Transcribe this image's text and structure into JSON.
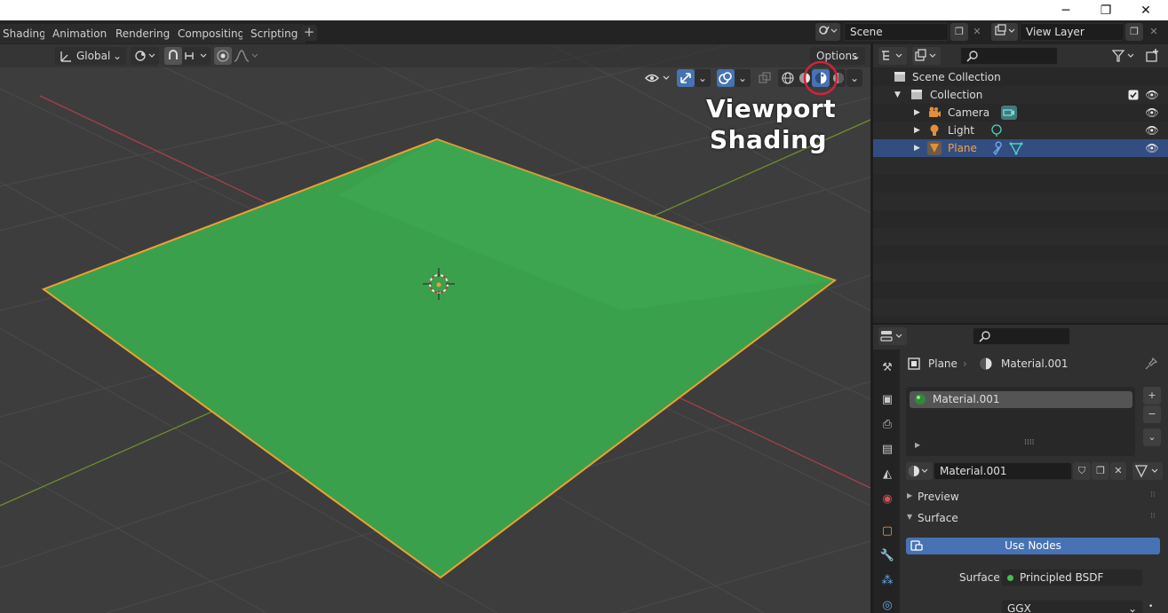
{
  "window": {
    "minimize_glyph": "─",
    "maximize_glyph": "❐",
    "close_glyph": "✕"
  },
  "workspace_tabs": [
    "Shading",
    "Animation",
    "Rendering",
    "Compositing",
    "Scripting"
  ],
  "add_tab_glyph": "+",
  "scene": {
    "name": "Scene"
  },
  "view_layer": {
    "name": "View Layer"
  },
  "viewport": {
    "transform_orientation": "Global",
    "options_label": "Options",
    "annotation_line1": "Viewport",
    "annotation_line2": "Shading",
    "annotation_highlight_color": "#d0243a",
    "plane_color": "#3aa04c",
    "plane_outline_color": "#f0a030",
    "x_axis_color": "#a4414a",
    "y_axis_color": "#6c8f2c"
  },
  "outliner": {
    "scene_collection": "Scene Collection",
    "collection": "Collection",
    "items": [
      {
        "label": "Camera",
        "icon": "camera-icon"
      },
      {
        "label": "Light",
        "icon": "light-icon"
      },
      {
        "label": "Plane",
        "icon": "mesh-icon",
        "selected": true
      }
    ]
  },
  "properties": {
    "breadcrumb_object": "Plane",
    "breadcrumb_material": "Material.001",
    "material_slots": [
      "Material.001"
    ],
    "material_name": "Material.001",
    "panels": {
      "preview": "Preview",
      "surface": "Surface"
    },
    "use_nodes_label": "Use Nodes",
    "surface_label": "Surface",
    "surface_value": "Principled BSDF",
    "distribution_value": "GGX",
    "accent_color": "#4772b3"
  }
}
